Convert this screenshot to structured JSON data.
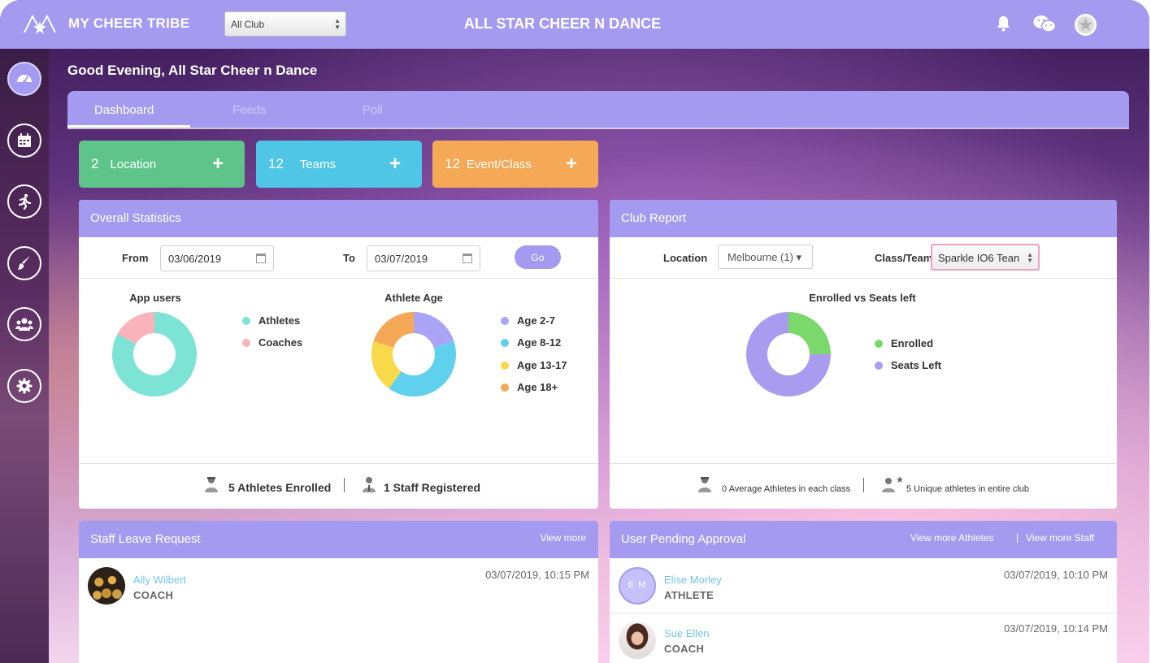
{
  "header": {
    "brand": "MY CHEER TRIBE",
    "club_select": "All Club",
    "title": "ALL STAR CHEER N DANCE",
    "icons": [
      "bell-icon",
      "wechat-icon",
      "star-avatar-icon"
    ]
  },
  "sidebar": {
    "items": [
      {
        "name": "dashboard",
        "icon": "speedometer-icon"
      },
      {
        "name": "calendar",
        "icon": "calendar-icon"
      },
      {
        "name": "athletes",
        "icon": "runner-icon"
      },
      {
        "name": "feeds",
        "icon": "brush-icon"
      },
      {
        "name": "users",
        "icon": "group-icon"
      },
      {
        "name": "settings",
        "icon": "gear-icon"
      }
    ]
  },
  "greeting": "Good Evening, All Star Cheer n Dance",
  "tabs": [
    {
      "label": "Dashboard"
    },
    {
      "label": "Feeds"
    },
    {
      "label": "Poll"
    }
  ],
  "stats": [
    {
      "count": "2",
      "label": "Location",
      "color": "#5fc48a"
    },
    {
      "count": "12",
      "label": "Teams",
      "color": "#4fc6e6"
    },
    {
      "count": "12",
      "label": "Event/Class",
      "color": "#f5a855"
    }
  ],
  "overall": {
    "title": "Overall Statistics",
    "from_label": "From",
    "from_value": "03/06/2019",
    "to_label": "To",
    "to_value": "03/07/2019",
    "go_label": "Go",
    "footer_enrolled": "5 Athletes Enrolled",
    "footer_staff": "1 Staff Registered"
  },
  "club": {
    "title": "Club Report",
    "location_label": "Location",
    "location_value": "Melbourne (1) ▾",
    "class_label": "Class/Team",
    "class_value": "Sparkle IO6 Tean",
    "footer_average": "0 Average Athletes in each class",
    "footer_unique": "5 Unique athletes in entire club"
  },
  "chart_data": [
    {
      "type": "pie",
      "title": "App users",
      "categories": [
        "Athletes",
        "Coaches"
      ],
      "values": [
        83,
        17
      ],
      "colors": [
        "#7de3d4",
        "#f8b3bb"
      ]
    },
    {
      "type": "pie",
      "title": "Athlete Age",
      "categories": [
        "Age 2-7",
        "Age 8-12",
        "Age 13-17",
        "Age 18+"
      ],
      "values": [
        20,
        40,
        20,
        20
      ],
      "colors": [
        "#a9a4f5",
        "#5fd0ee",
        "#f8d94a",
        "#f5a855"
      ]
    },
    {
      "type": "pie",
      "title": "Enrolled vs Seats left",
      "categories": [
        "Enrolled",
        "Seats Left"
      ],
      "values": [
        25,
        75
      ],
      "colors": [
        "#7bd86a",
        "#a99cf0"
      ]
    }
  ],
  "leave": {
    "title": "Staff Leave Request",
    "view_more": "View more",
    "rows": [
      {
        "name": "Ally Wilbert",
        "role": "COACH",
        "time": "03/07/2019, 10:15 PM"
      }
    ]
  },
  "pending": {
    "title": "User Pending Approval",
    "view_athletes": "View more Athletes",
    "sep": "|",
    "view_staff": "View more Staff",
    "rows": [
      {
        "initials": "E M",
        "name": "Elise Morley",
        "role": "ATHLETE",
        "time": "03/07/2019, 10:10 PM"
      },
      {
        "name": "Sue Ellen",
        "role": "COACH",
        "time": "03/07/2019, 10:14 PM"
      }
    ]
  }
}
